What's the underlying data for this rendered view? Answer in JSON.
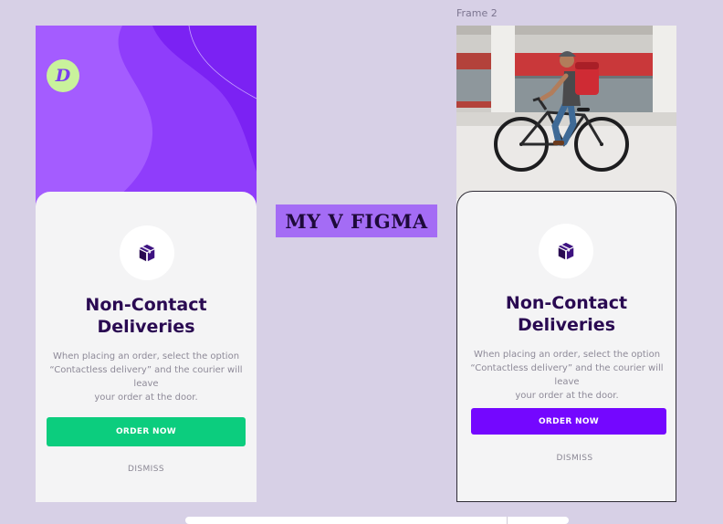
{
  "frame_label": "Frame 2",
  "center_label": "MY V FIGMA",
  "left_card": {
    "logo_letter": "D",
    "title_line1": "Non-Contact",
    "title_line2": "Deliveries",
    "desc_line1": "When placing an order, select the option",
    "desc_line2": "“Contactless delivery” and the courier will leave",
    "desc_line3": "your order at the door.",
    "order_button": "ORDER NOW",
    "dismiss": "DISMISS",
    "button_color": "#0ccd7e",
    "hero_color": "#8c3cfb"
  },
  "right_card": {
    "title_line1": "Non-Contact",
    "title_line2": "Deliveries",
    "desc_line1": "When placing an order, select the option",
    "desc_line2": "“Contactless delivery” and the courier will leave",
    "desc_line3": "your order at the door.",
    "order_button": "ORDER NOW",
    "dismiss": "DISMISS",
    "button_color": "#7407ff"
  },
  "icons": {
    "logo": "brand-logo-icon",
    "package": "package-box-icon",
    "photo": "courier-bicycle-photo"
  }
}
